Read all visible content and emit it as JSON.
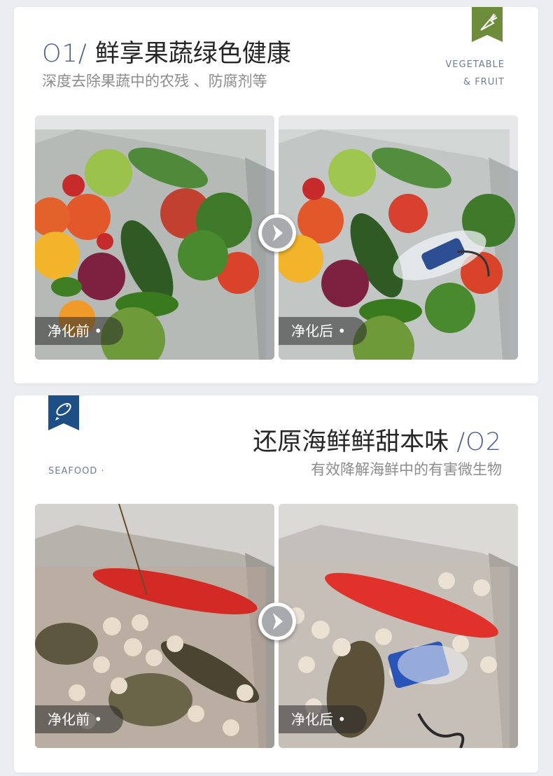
{
  "sections": [
    {
      "number": "O1/",
      "title": "鲜享果蔬绿色健康",
      "subtitle": "深度去除果蔬中的农残 、防腐剂等",
      "tag_line1": "VEGETABLE",
      "tag_line2": "& FRUIT",
      "ribbon_icon": "carrot-icon",
      "ribbon_color": "#6e8d3a",
      "before_label": "净化前 •",
      "after_label": "净化后 •"
    },
    {
      "number": "/O2",
      "title": "还原海鲜鲜甜本味",
      "subtitle": "有效降解海鲜中的有害微生物",
      "tag": "SEAFOOD ·",
      "ribbon_icon": "fish-icon",
      "ribbon_color": "#1d4f86",
      "before_label": "净化前 •",
      "after_label": "净化后 •"
    }
  ],
  "icons": {
    "next_arrow": "chevron-right-icon"
  }
}
